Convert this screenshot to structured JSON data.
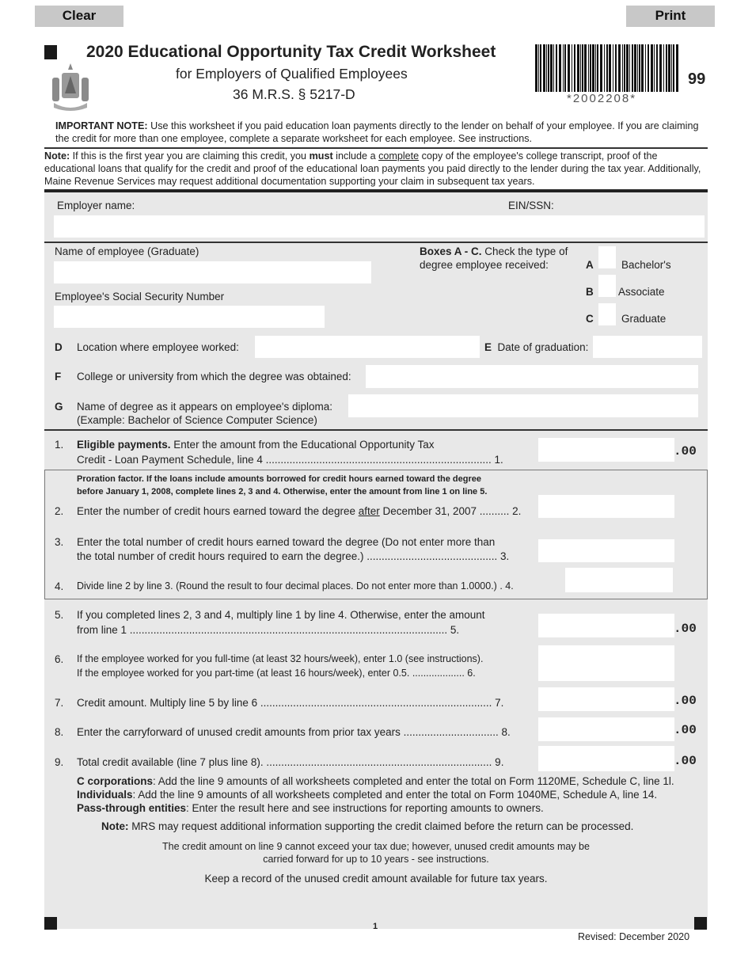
{
  "buttons": {
    "clear": "Clear",
    "print": "Print"
  },
  "header": {
    "title": "2020 Educational Opportunity Tax Credit Worksheet",
    "subtitle": "for Employers of Qualified Employees",
    "statute": "36 M.R.S. § 5217-D",
    "barcode_text": "*2002208*",
    "form_code": "99"
  },
  "notes": {
    "important_label": "IMPORTANT NOTE:",
    "important_text": " Use this worksheet if you paid education loan payments directly to the lender on behalf of your employee.  If you are claiming the credit for more than one employee, complete a separate worksheet for each employee.  See instructions.",
    "note_label": "Note:",
    "note_text_1": " If this is the first year you are claiming this credit, you ",
    "note_must": "must",
    "note_text_2": " include a ",
    "note_complete": "complete",
    "note_text_3": " copy of the employee's college transcript, proof of the educational loans that qualify for the credit and proof of the educational loan payments you paid directly to the lender during the tax year. Additionally, Maine Revenue Services may request additional documentation supporting your claim in subsequent tax years."
  },
  "fields": {
    "employer_name": "Employer name:",
    "ein_ssn": "EIN/SSN:",
    "employee_name": "Name of employee (Graduate)",
    "employee_ssn": "Employee's Social Security Number",
    "boxes_bold": "Boxes A - C.",
    "boxes_text_1": " Check the type of",
    "boxes_text_2": "degree employee received:",
    "degree_options": [
      {
        "letter": "A",
        "label": "Bachelor's"
      },
      {
        "letter": "B",
        "label": "Associate"
      },
      {
        "letter": "C",
        "label": "Graduate"
      }
    ],
    "d_letter": "D",
    "d_label": "Location where employee worked:",
    "e_letter": "E",
    "e_label": "Date of graduation:",
    "f_letter": "F",
    "f_label": "College or university from which the degree was obtained:",
    "g_letter": "G",
    "g_label_1": "Name of degree as it appears on employee's diploma:",
    "g_label_2": "(Example: Bachelor of Science Computer Science)"
  },
  "lines": {
    "l1_num": "1.",
    "l1_bold": "Eligible payments.",
    "l1_text_1": "  Enter the amount from the Educational Opportunity Tax",
    "l1_text_2": "Credit - Loan Payment Schedule, line 4 ............................................................................ 1.",
    "proration_1": "Proration factor. If the loans include amounts borrowed for credit hours earned toward the degree",
    "proration_2": "before January 1, 2008, complete lines 2, 3 and 4. Otherwise, enter the amount from line 1 on line 5.",
    "l2_num": "2.",
    "l2_text_1": "Enter the number of credit hours earned toward the degree ",
    "l2_after": "after",
    "l2_text_2": " December 31, 2007 .......... 2.",
    "l3_num": "3.",
    "l3_text_1": "Enter the total number of credit hours earned toward the degree (Do not enter more than",
    "l3_text_2": "the total number of credit hours required to earn the degree.) ............................................ 3.",
    "l4_num": "4.",
    "l4_text": "Divide line 2 by line 3. (Round the result to four decimal places. Do not enter more than 1.0000.)  .  4.",
    "l5_num": "5.",
    "l5_text_1": "If you completed lines 2, 3 and 4, multiply line 1 by line 4. Otherwise, enter the amount",
    "l5_text_2": "from line 1 ........................................................................................................... 5.",
    "l6_num": "6.",
    "l6_text_1": "If the employee worked for you full-time (at least 32 hours/week), enter 1.0 (see instructions).",
    "l6_text_2": "If the employee worked for you part-time (at least 16 hours/week), enter 0.5.  ................... 6.",
    "l7_num": "7.",
    "l7_text": "Credit amount.  Multiply line 5 by line 6 .............................................................................. 7.",
    "l8_num": "8.",
    "l8_text": "Enter the carryforward of unused credit amounts from prior tax years ................................ 8.",
    "l9_num": "9.",
    "l9_text": "Total credit available (line 7 plus line 8). ............................................................................ 9.",
    "cents": ".00"
  },
  "footer": {
    "ccorp_bold": "C corporations",
    "ccorp_text": ":  Add the line 9 amounts of all worksheets completed and enter the total on Form 1120ME, Schedule C, line 1l.",
    "ind_bold": "Individuals",
    "ind_text": ":  Add the line 9 amounts of all worksheets completed and enter the total on Form 1040ME, Schedule A, line 14.",
    "pass_bold": "Pass-through entities",
    "pass_text": ":  Enter the result here and see instructions for reporting amounts to owners.",
    "mrs_bold": "Note:",
    "mrs_text": " MRS may request additional information supporting the credit claimed before the return can be processed.",
    "carry_1": "The credit amount on line 9 cannot exceed your tax due; however, unused credit amounts may be",
    "carry_2": "carried forward for up to 10 years - see instructions.",
    "keep": "Keep a record of the unused credit amount available for future tax years.",
    "page_number": "1",
    "revised": "Revised: December 2020"
  },
  "colors": {
    "panel": "#e8e8e8",
    "button": "#c8c8c8",
    "field": "#ffffff"
  }
}
